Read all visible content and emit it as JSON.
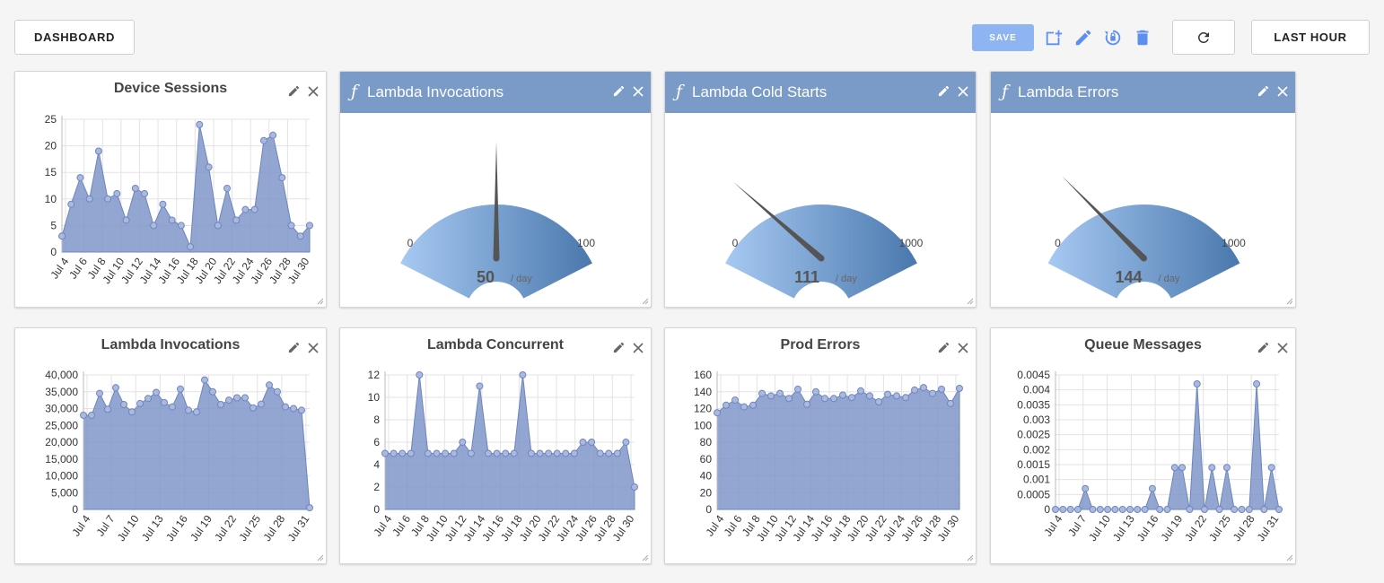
{
  "header": {
    "dashboard_label": "DASHBOARD",
    "save_label": "SAVE",
    "time_range_label": "LAST HOUR",
    "tools": [
      "add-widget-icon",
      "edit-icon",
      "restore-icon",
      "delete-icon",
      "refresh-icon"
    ]
  },
  "colors": {
    "area_fill": "#7f96c9",
    "area_stroke": "#6d85bd",
    "gauge_header": "#7a9ac7",
    "accent": "#8fb4f2"
  },
  "widgets": [
    {
      "title": "Device Sessions",
      "chart_data": {
        "type": "area",
        "ylim": [
          0,
          25
        ],
        "yticks": [
          "25",
          "20",
          "15",
          "10",
          "5",
          "0"
        ],
        "xticks": [
          "Jul 4",
          "Jul 6",
          "Jul 8",
          "Jul 10",
          "Jul 12",
          "Jul 14",
          "Jul 16",
          "Jul 18",
          "Jul 20",
          "Jul 22",
          "Jul 24",
          "Jul 26",
          "Jul 28",
          "Jul 30"
        ],
        "values": [
          3,
          9,
          14,
          10,
          19,
          10,
          11,
          6,
          12,
          11,
          5,
          9,
          6,
          5,
          1,
          24,
          16,
          5,
          12,
          6,
          8,
          8,
          21,
          22,
          14,
          5,
          3,
          5
        ]
      }
    },
    {
      "title": "Lambda Invocations",
      "gauge": {
        "value": "50",
        "unit": "/ day",
        "min": "0",
        "max": "100",
        "fraction": 0.5
      }
    },
    {
      "title": "Lambda Cold Starts",
      "gauge": {
        "value": "111",
        "unit": "/ day",
        "min": "0",
        "max": "1000",
        "fraction": 0.111
      }
    },
    {
      "title": "Lambda Errors",
      "gauge": {
        "value": "144",
        "unit": "/ day",
        "min": "0",
        "max": "1000",
        "fraction": 0.144
      }
    },
    {
      "title": "Lambda Invocations",
      "chart_data": {
        "type": "area",
        "ylim": [
          0,
          40000
        ],
        "yticks": [
          "40,000",
          "35,000",
          "30,000",
          "25,000",
          "20,000",
          "15,000",
          "10,000",
          "5,000",
          "0"
        ],
        "xticks": [
          "Jul 4",
          "Jul 7",
          "Jul 10",
          "Jul 13",
          "Jul 16",
          "Jul 19",
          "Jul 22",
          "Jul 25",
          "Jul 28",
          "Jul 31"
        ],
        "values": [
          28000,
          28000,
          34500,
          29800,
          36200,
          31200,
          29000,
          31500,
          33000,
          34800,
          31800,
          30500,
          35800,
          29500,
          29000,
          38500,
          35000,
          31200,
          32500,
          33200,
          33200,
          30200,
          31300,
          37000,
          35000,
          30500,
          30000,
          29500,
          500
        ]
      }
    },
    {
      "title": "Lambda Concurrent",
      "chart_data": {
        "type": "area",
        "ylim": [
          0,
          12
        ],
        "yticks": [
          "12",
          "10",
          "8",
          "6",
          "4",
          "2",
          "0"
        ],
        "xticks": [
          "Jul 4",
          "Jul 6",
          "Jul 8",
          "Jul 10",
          "Jul 12",
          "Jul 14",
          "Jul 16",
          "Jul 18",
          "Jul 20",
          "Jul 22",
          "Jul 24",
          "Jul 26",
          "Jul 28",
          "Jul 30"
        ],
        "values": [
          5,
          5,
          5,
          5,
          12,
          5,
          5,
          5,
          5,
          6,
          5,
          11,
          5,
          5,
          5,
          5,
          12,
          5,
          5,
          5,
          5,
          5,
          5,
          6,
          6,
          5,
          5,
          5,
          6,
          2
        ]
      }
    },
    {
      "title": "Prod Errors",
      "chart_data": {
        "type": "area",
        "ylim": [
          0,
          160
        ],
        "yticks": [
          "160",
          "140",
          "120",
          "100",
          "80",
          "60",
          "40",
          "20",
          "0"
        ],
        "xticks": [
          "Jul 4",
          "Jul 6",
          "Jul 8",
          "Jul 10",
          "Jul 12",
          "Jul 14",
          "Jul 16",
          "Jul 18",
          "Jul 20",
          "Jul 22",
          "Jul 24",
          "Jul 26",
          "Jul 28",
          "Jul 30"
        ],
        "values": [
          115,
          124,
          130,
          122,
          124,
          138,
          135,
          138,
          132,
          143,
          125,
          140,
          132,
          132,
          136,
          133,
          141,
          135,
          128,
          137,
          135,
          133,
          142,
          145,
          138,
          143,
          126,
          144
        ]
      }
    },
    {
      "title": "Queue Messages",
      "chart_data": {
        "type": "area",
        "ylim": [
          0,
          0.0045
        ],
        "yticks": [
          "0.0045",
          "0.004",
          "0.0035",
          "0.003",
          "0.0025",
          "0.002",
          "0.0015",
          "0.001",
          "0.0005",
          "0"
        ],
        "xticks": [
          "Jul 4",
          "Jul 7",
          "Jul 10",
          "Jul 13",
          "Jul 16",
          "Jul 19",
          "Jul 22",
          "Jul 25",
          "Jul 28",
          "Jul 31"
        ],
        "values": [
          0,
          0,
          0,
          0,
          0.0007,
          0,
          0,
          0,
          0,
          0,
          0,
          0,
          0,
          0.0007,
          0,
          0,
          0.0014,
          0.0014,
          0,
          0.0042,
          0,
          0.0014,
          0,
          0.0014,
          0,
          0,
          0,
          0.0042,
          0,
          0.0014,
          0
        ]
      }
    }
  ]
}
